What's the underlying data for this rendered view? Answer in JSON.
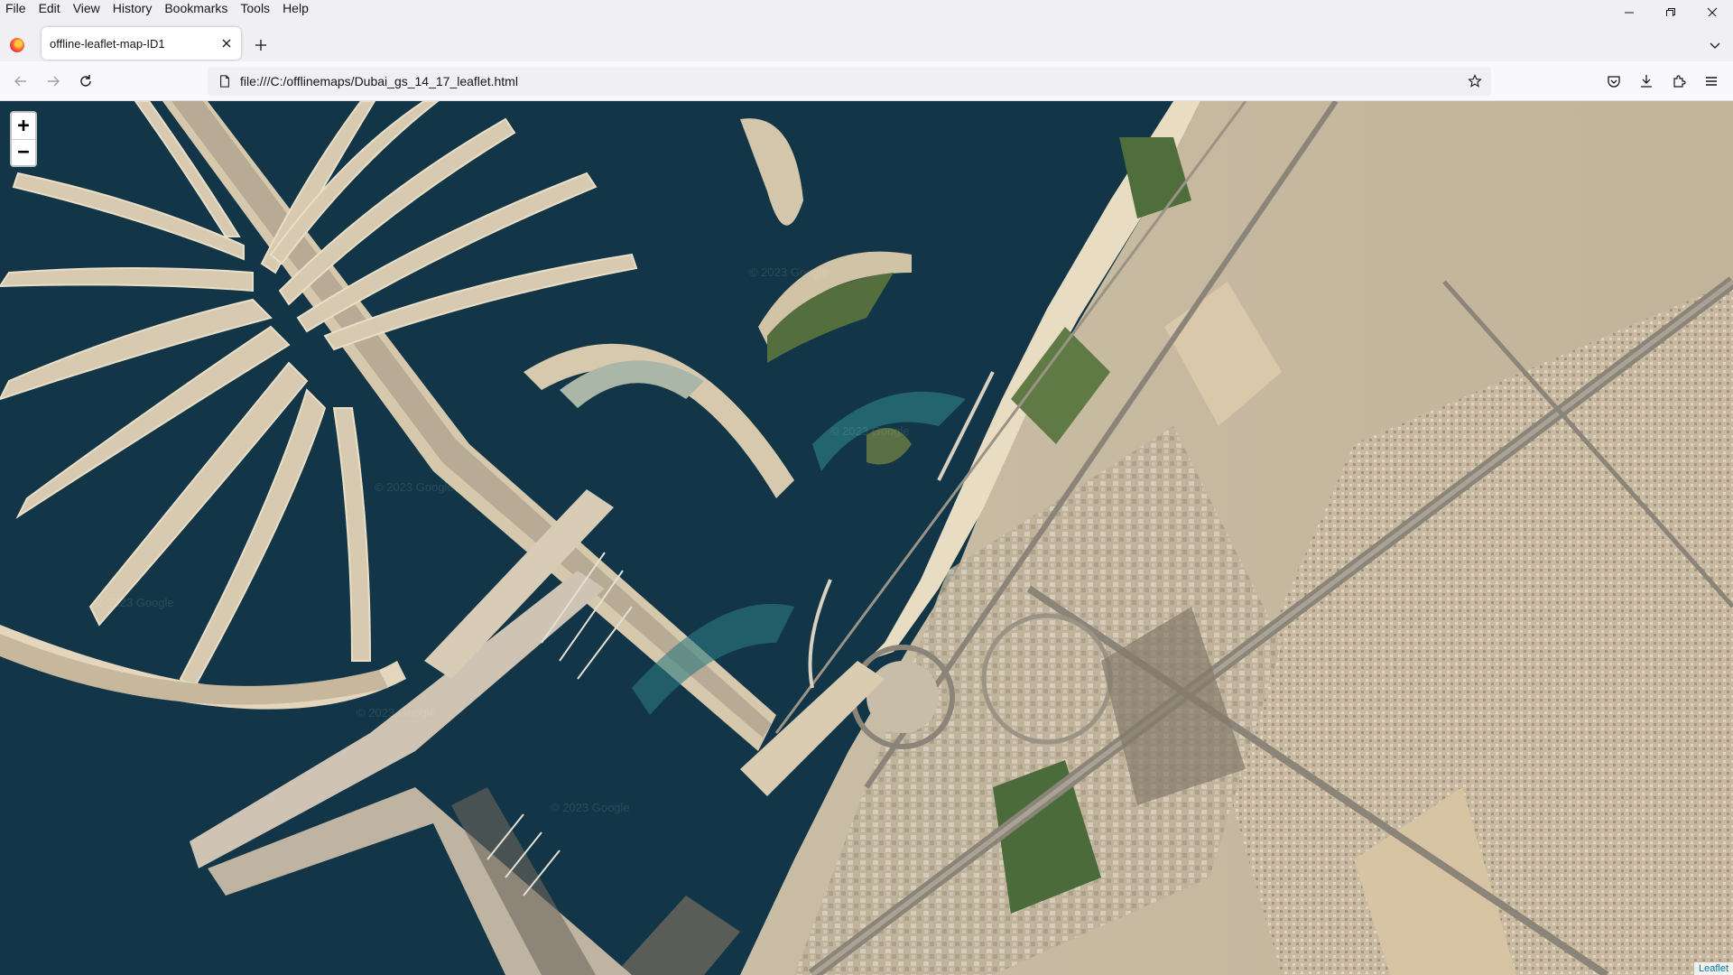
{
  "menu": [
    "File",
    "Edit",
    "View",
    "History",
    "Bookmarks",
    "Tools",
    "Help"
  ],
  "tab": {
    "title": "offline-leaflet-map-ID1"
  },
  "urlbar": {
    "url": "file:///C:/offlinemaps/Dubai_gs_14_17_leaflet.html"
  },
  "map": {
    "zoom_in": "+",
    "zoom_out": "−",
    "attribution": "Leaflet",
    "watermark": "© 2023 Google"
  },
  "icons": {
    "app": "firefox-icon",
    "tab_close": "close-icon",
    "new_tab": "plus-icon",
    "tab_list": "chevron-down-icon",
    "back": "arrow-left-icon",
    "forward": "arrow-right-icon",
    "reload": "reload-icon",
    "page": "page-icon",
    "bookmark": "star-icon",
    "pocket": "pocket-icon",
    "downloads": "download-icon",
    "extensions": "puzzle-icon",
    "menu": "hamburger-icon"
  },
  "colors": {
    "chrome": "#f0f0f4",
    "sea_deep": "#0f3345",
    "sea_shallow": "#2d7d83",
    "sand": "#d9cdb5",
    "urban": "#b7ab98",
    "link": "#0078a8"
  }
}
